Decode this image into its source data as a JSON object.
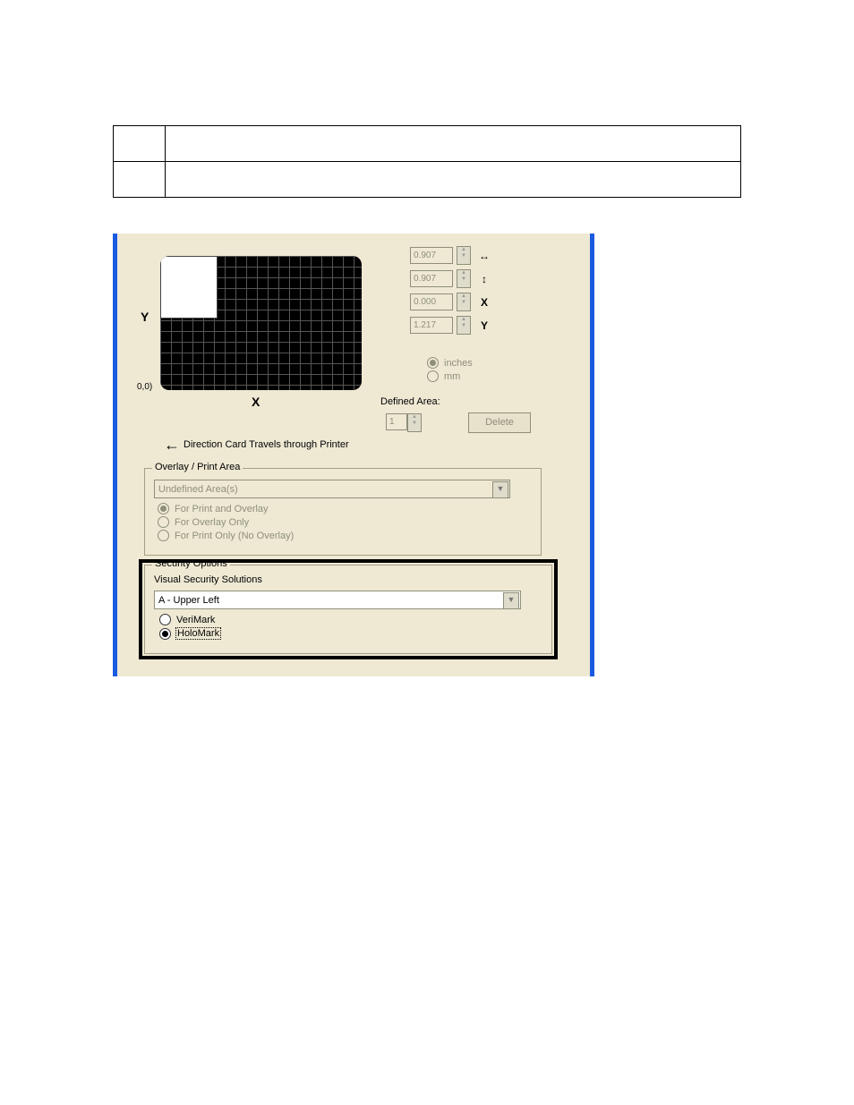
{
  "spinners": {
    "width": {
      "value": "0.907",
      "icon": "↔"
    },
    "height": {
      "value": "0.907",
      "icon": "↕"
    },
    "x": {
      "value": "0.000",
      "icon": "X"
    },
    "y": {
      "value": "1.217",
      "icon": "Y"
    }
  },
  "units": {
    "inches_label": "inches",
    "mm_label": "mm"
  },
  "defined_area": {
    "label": "Defined Area:",
    "value": "1",
    "delete_label": "Delete"
  },
  "axes": {
    "y": "Y",
    "x": "X",
    "origin": "0,0)"
  },
  "direction_text": "Direction Card Travels through Printer",
  "overlay_group": {
    "legend": "Overlay / Print Area",
    "dropdown_value": "Undefined Area(s)",
    "opt1": "For Print and Overlay",
    "opt2": "For Overlay Only",
    "opt3": "For Print Only (No Overlay)"
  },
  "security_group": {
    "legend": "Security Options",
    "subtitle": "Visual Security Solutions",
    "dropdown_value": "A - Upper Left",
    "opt_verimark": "VeriMark",
    "opt_holomark": "HoloMark"
  }
}
